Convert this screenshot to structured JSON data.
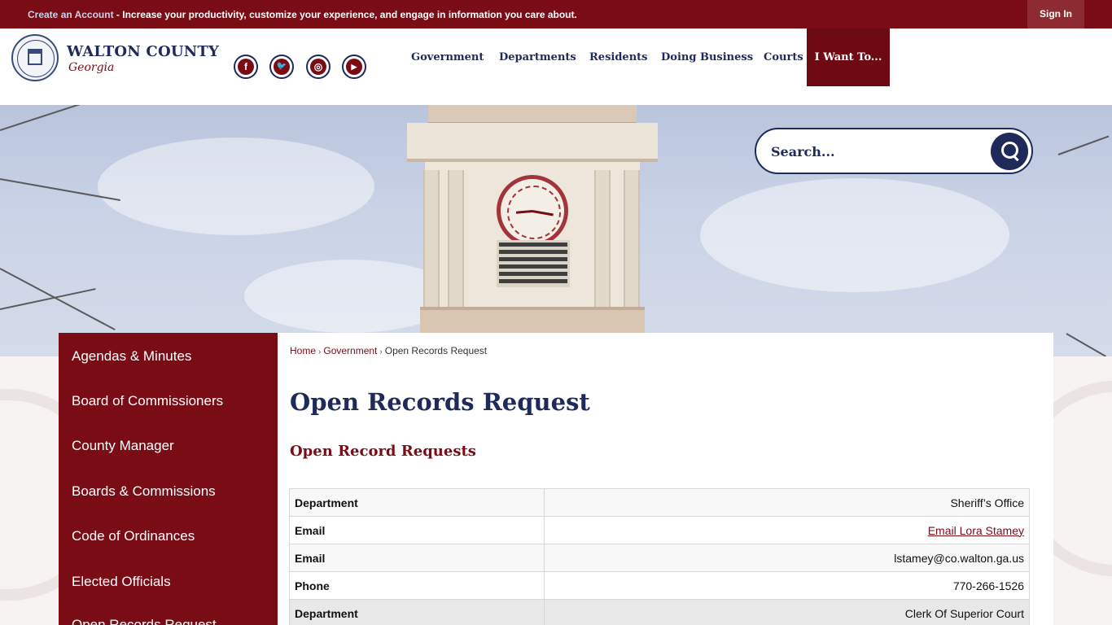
{
  "topbar": {
    "create_account_link": "Create an Account",
    "message": " - Increase your productivity, customize your experience, and engage in information you care about.",
    "sign_in": "Sign In"
  },
  "brand": {
    "name": "WALTON COUNTY",
    "state": "Georgia"
  },
  "social": [
    {
      "icon": "facebook-icon",
      "glyph": "f"
    },
    {
      "icon": "twitter-icon",
      "glyph": "🐦"
    },
    {
      "icon": "instagram-icon",
      "glyph": "◎"
    },
    {
      "icon": "youtube-icon",
      "glyph": "▶"
    }
  ],
  "nav": {
    "items": [
      "Government",
      "Departments",
      "Residents",
      "Doing Business",
      "Courts"
    ],
    "want": "I Want To..."
  },
  "search": {
    "placeholder": "Search..."
  },
  "sidebar": {
    "items": [
      "Agendas & Minutes",
      "Board of Commissioners",
      "County Manager",
      "Boards & Commissions",
      "Code of Ordinances",
      "Elected Officials",
      "Open Records Request"
    ]
  },
  "breadcrumb": {
    "home": "Home",
    "government": "Government",
    "current": "Open Records Request"
  },
  "page": {
    "title": "Open Records Request",
    "subtitle": "Open Record Requests"
  },
  "records": [
    {
      "key": "Department",
      "value": "Sheriff’s Office"
    },
    {
      "key": "Email",
      "value": "Email Lora Stamey",
      "link": true
    },
    {
      "key": "Email",
      "value": "lstamey@co.walton.ga.us"
    },
    {
      "key": "Phone",
      "value": "770-266-1526"
    },
    {
      "key": "Department",
      "value": "Clerk Of Superior Court"
    }
  ],
  "colors": {
    "maroon": "#7a0c16",
    "navy": "#1f2a5a"
  }
}
